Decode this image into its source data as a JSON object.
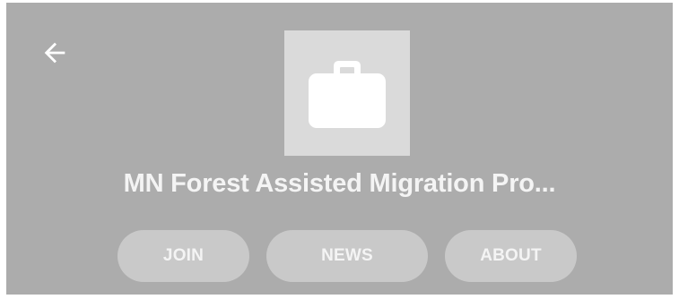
{
  "header": {
    "back_icon": "arrow-left-icon",
    "image_icon": "briefcase-icon",
    "title": "MN Forest Assisted Migration Pro..."
  },
  "actions": {
    "join_label": "JOIN",
    "news_label": "NEWS",
    "about_label": "ABOUT"
  },
  "colors": {
    "header_background": "#acacac",
    "image_background": "#dadada",
    "button_background": "#c9c9c9",
    "text": "#f4f4f4"
  }
}
